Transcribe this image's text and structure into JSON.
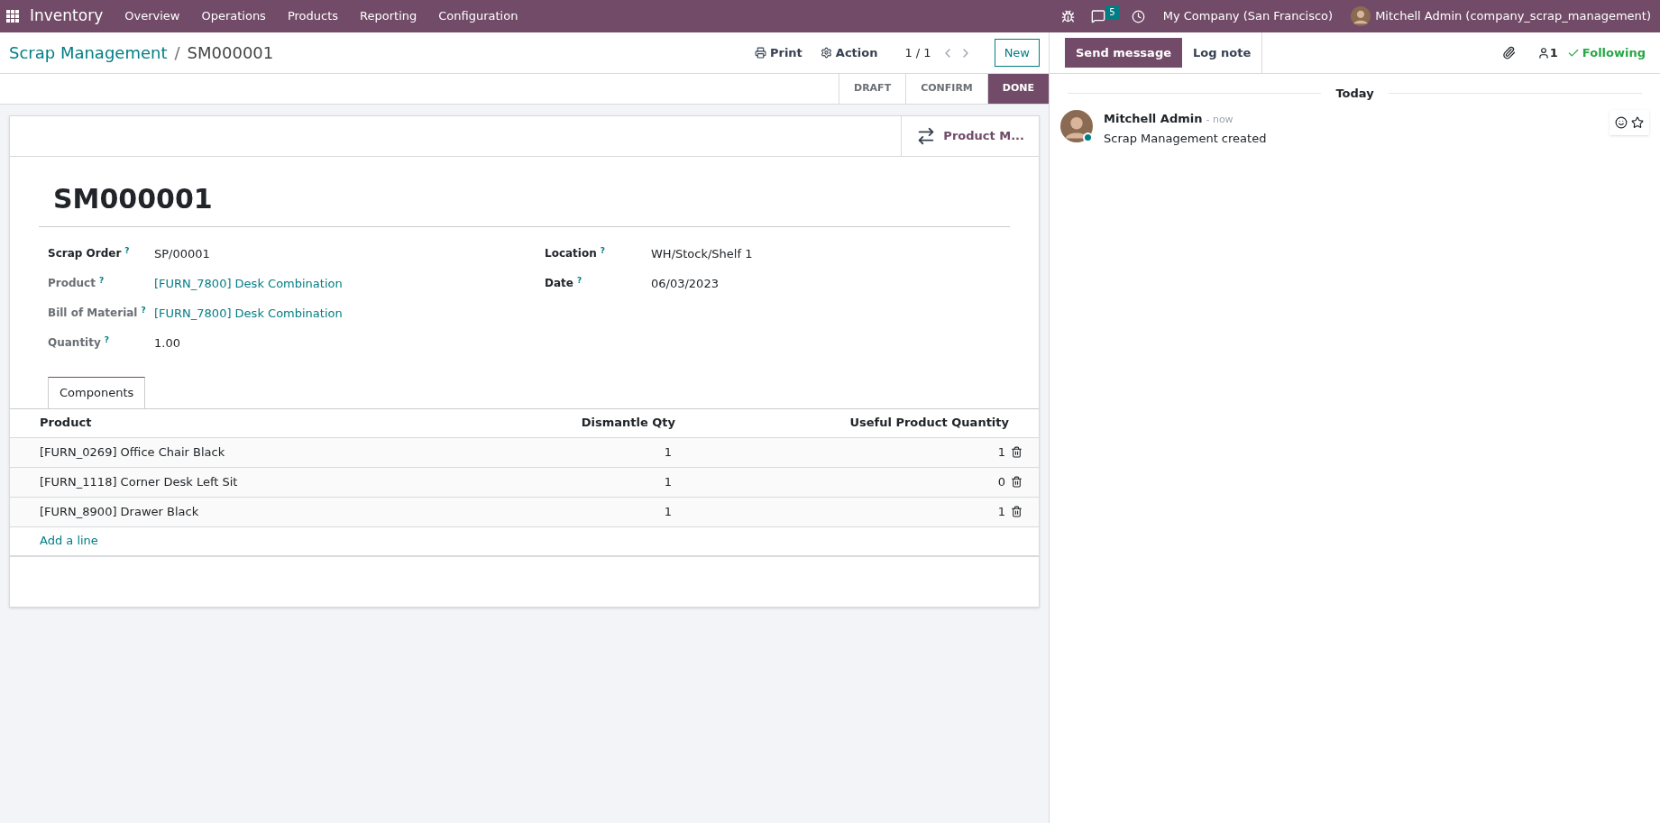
{
  "navbar": {
    "app": "Inventory",
    "menu": [
      "Overview",
      "Operations",
      "Products",
      "Reporting",
      "Configuration"
    ],
    "messages_count": "5",
    "company": "My Company (San Francisco)",
    "user": "Mitchell Admin (company_scrap_management)"
  },
  "breadcrumb": {
    "parent": "Scrap Management",
    "separator": "/",
    "current": "SM000001"
  },
  "actions": {
    "print": "Print",
    "action": "Action",
    "pager": "1 / 1",
    "new": "New"
  },
  "stages": [
    {
      "label": "DRAFT",
      "selected": false
    },
    {
      "label": "CONFIRM",
      "selected": false
    },
    {
      "label": "DONE",
      "selected": true
    }
  ],
  "smart_button": "Product M...",
  "record_name": "SM000001",
  "fields_left": [
    {
      "label": "Scrap Order",
      "help": "?",
      "value": "SP/00001",
      "muted": false,
      "link": false
    },
    {
      "label": "Product",
      "help": "?",
      "value": "[FURN_7800] Desk Combination",
      "muted": true,
      "link": true
    },
    {
      "label": "Bill of Material",
      "help": "?",
      "value": "[FURN_7800] Desk Combination",
      "muted": true,
      "link": true
    },
    {
      "label": "Quantity",
      "help": "?",
      "value": "1.00",
      "muted": true,
      "link": false
    }
  ],
  "fields_right": [
    {
      "label": "Location",
      "help": "?",
      "value": "WH/Stock/Shelf 1",
      "muted": false,
      "link": false
    },
    {
      "label": "Date",
      "help": "?",
      "value": "06/03/2023",
      "muted": false,
      "link": false
    }
  ],
  "tabs": [
    {
      "label": "Components",
      "selected": true
    }
  ],
  "table": {
    "columns": [
      "Product",
      "Dismantle Qty",
      "Useful Product Quantity"
    ],
    "rows": [
      {
        "product": "[FURN_0269] Office Chair Black",
        "dismantle_qty": "1",
        "useful_qty": "1"
      },
      {
        "product": "[FURN_1118] Corner Desk Left Sit",
        "dismantle_qty": "1",
        "useful_qty": "0"
      },
      {
        "product": "[FURN_8900] Drawer Black",
        "dismantle_qty": "1",
        "useful_qty": "1"
      }
    ],
    "add_line": "Add a line"
  },
  "chatter": {
    "buttons": [
      {
        "label": "Send message",
        "selected": true
      },
      {
        "label": "Log note",
        "selected": false
      }
    ],
    "followers": "1",
    "following": "Following",
    "date_separator": "Today",
    "messages": [
      {
        "author": "Mitchell Admin",
        "time": "- now",
        "body": "Scrap Management created"
      }
    ]
  }
}
